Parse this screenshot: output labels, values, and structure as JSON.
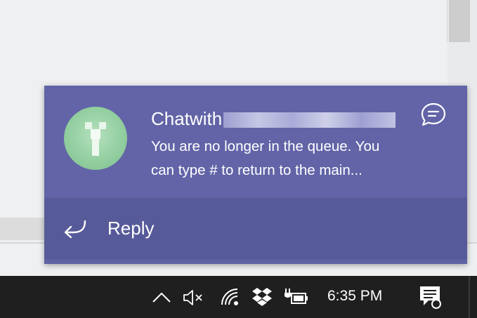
{
  "notification": {
    "sender_visible": "Chatwith",
    "sender_redacted": true,
    "message_line1": "You are no longer in the queue. You",
    "message_line2": "can type # to return to the main...",
    "reply_label": "Reply"
  },
  "taskbar": {
    "time": "6:35 PM",
    "icons": [
      "chevron-up-icon",
      "speaker-muted-icon",
      "wifi-icon",
      "dropbox-icon",
      "power-plug-icon",
      "battery-icon",
      "action-center-icon"
    ]
  },
  "colors": {
    "toast_bg": "#6264a7",
    "toast_footer_bg": "#575a99",
    "taskbar_bg": "#1f1f1f"
  }
}
